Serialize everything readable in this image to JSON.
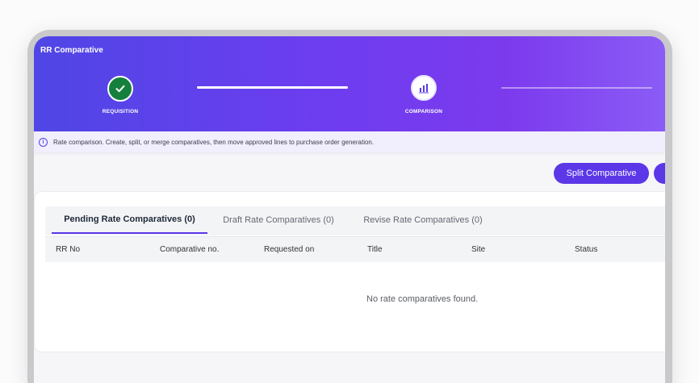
{
  "app": {
    "title": "RR Comparative"
  },
  "steps": [
    {
      "label": "REQUISITION",
      "state": "done",
      "icon": "check-icon"
    },
    {
      "label": "COMPARISON",
      "state": "active",
      "icon": "bar-chart-icon"
    }
  ],
  "info": {
    "icon": "info-icon",
    "text": "Rate comparison. Create, split, or merge comparatives, then move approved lines to purchase order generation."
  },
  "actions": {
    "split_label": "Split Comparative"
  },
  "tabs": [
    {
      "label": "Pending Rate Comparatives (0)",
      "active": true
    },
    {
      "label": "Draft Rate Comparatives (0)",
      "active": false
    },
    {
      "label": "Revise Rate Comparatives (0)",
      "active": false
    }
  ],
  "table": {
    "columns": [
      "RR No",
      "Comparative no.",
      "Requested on",
      "Title",
      "Site",
      "Status"
    ],
    "rows": [],
    "empty_message": "No rate comparatives found."
  },
  "colors": {
    "accent": "#5b37e8",
    "success": "#15803d",
    "header_start": "#4f46e5",
    "header_end": "#8b5cf6"
  }
}
